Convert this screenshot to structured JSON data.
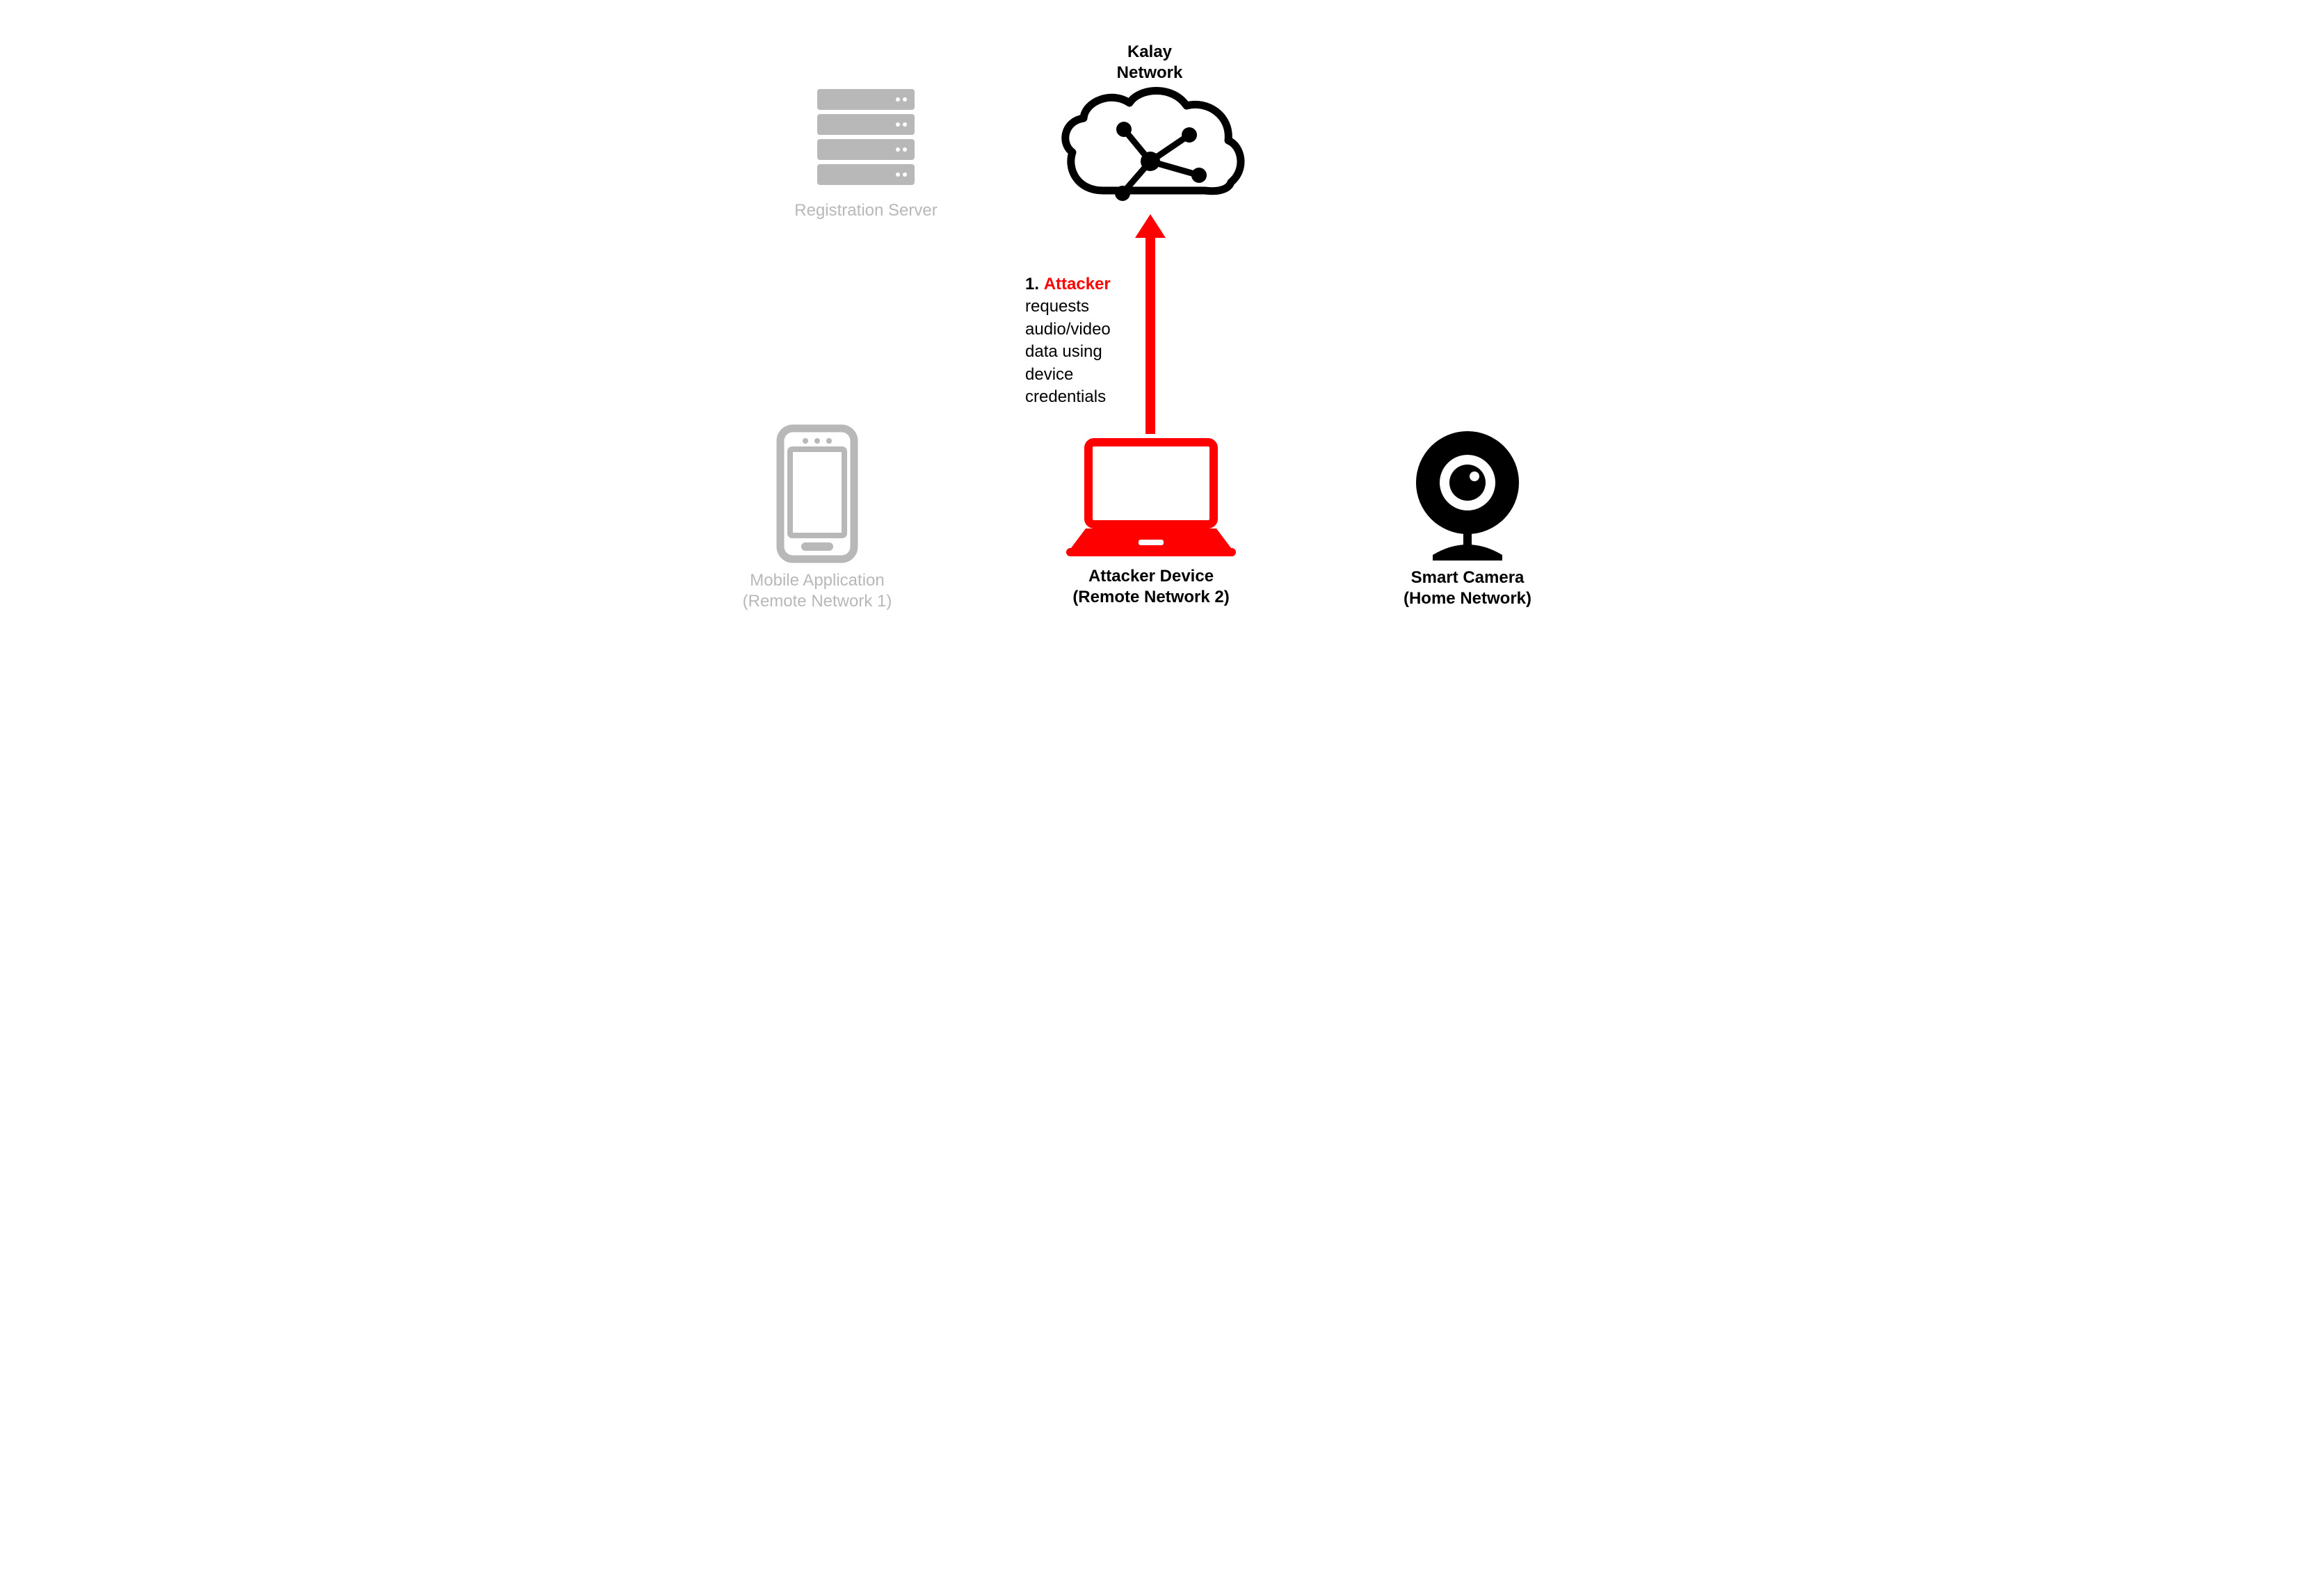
{
  "nodes": {
    "cloud": {
      "label": "Kalay\nNetwork"
    },
    "server": {
      "label": "Registration Server"
    },
    "mobile": {
      "label_line1": "Mobile Application",
      "label_line2": "(Remote Network 1)"
    },
    "attacker": {
      "label_line1": "Attacker Device",
      "label_line2": "(Remote Network 2)"
    },
    "camera": {
      "label_line1": "Smart Camera",
      "label_line2": "(Home Network)"
    }
  },
  "annotation": {
    "step": "1.",
    "actor": "Attacker",
    "text_line1": "requests",
    "text_line2": "audio/video",
    "text_line3": "data using",
    "text_line4": "device",
    "text_line5": "credentials"
  },
  "colors": {
    "red": "#ff0000",
    "gray": "#b8b8b8",
    "black": "#000000"
  }
}
